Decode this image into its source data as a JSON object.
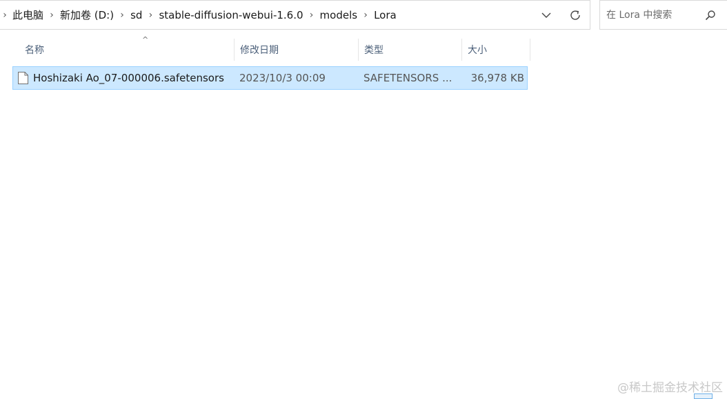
{
  "address": {
    "breadcrumbs": [
      "此电脑",
      "新加卷 (D:)",
      "sd",
      "stable-diffusion-webui-1.6.0",
      "models",
      "Lora"
    ],
    "separator": "›"
  },
  "search": {
    "placeholder": "在 Lora 中搜索"
  },
  "columns": {
    "name": "名称",
    "date": "修改日期",
    "type": "类型",
    "size": "大小"
  },
  "files": [
    {
      "name": "Hoshizaki Ao_07-000006.safetensors",
      "date": "2023/10/3 00:09",
      "type": "SAFETENSORS ...",
      "size": "36,978 KB",
      "selected": true,
      "icon": "file-icon"
    }
  ],
  "watermark": "@稀土掘金技术社区",
  "colors": {
    "selection_bg": "#cce8ff",
    "selection_border": "#99d1ff",
    "header_text": "#4c607a"
  }
}
